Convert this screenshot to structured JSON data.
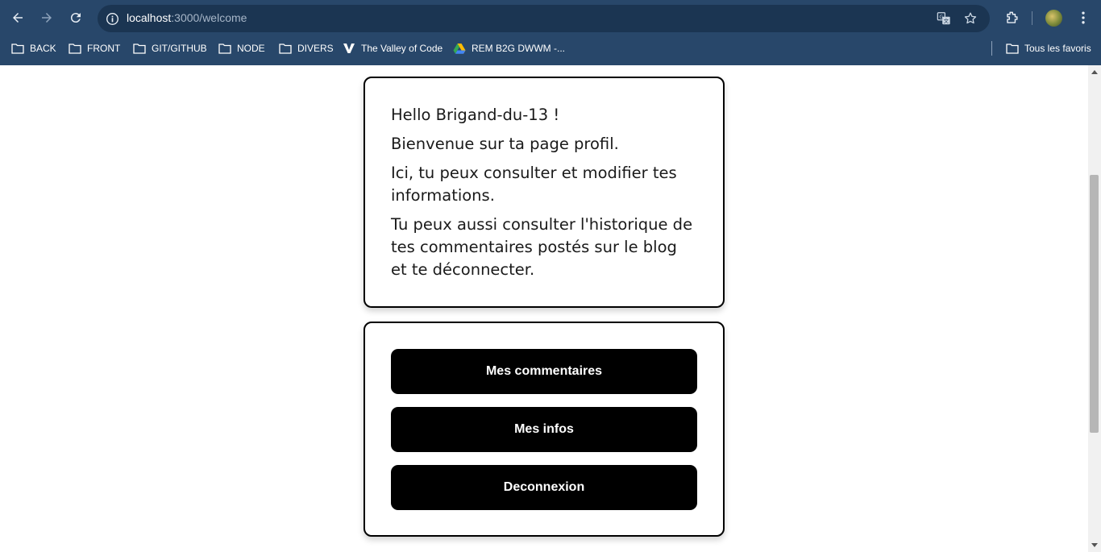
{
  "browser": {
    "url_host": "localhost",
    "url_path": ":3000/welcome",
    "bookmarks": [
      {
        "label": "BACK",
        "icon": "folder-icon"
      },
      {
        "label": "FRONT",
        "icon": "folder-icon"
      },
      {
        "label": "GIT/GITHUB",
        "icon": "folder-icon"
      },
      {
        "label": "NODE",
        "icon": "folder-icon"
      },
      {
        "label": "DIVERS",
        "icon": "folder-icon"
      },
      {
        "label": "The Valley of Code",
        "icon": "valley-logo-icon"
      },
      {
        "label": "REM B2G DWWM -...",
        "icon": "google-drive-icon"
      }
    ],
    "all_bookmarks_label": "Tous les favoris",
    "colors": {
      "chrome_bg": "#28476a",
      "omnibox_bg": "#1b3552"
    }
  },
  "profile": {
    "greeting": "Hello Brigand-du-13 !",
    "welcome": "Bienvenue sur ta page profil.",
    "info_text": "Ici, tu peux consulter et modifier tes informations.",
    "history_text": "Tu peux aussi consulter l'historique de tes commentaires postés sur le blog et te déconnecter."
  },
  "actions": {
    "comments_button": "Mes commentaires",
    "infos_button": "Mes infos",
    "logout_button": "Deconnexion"
  }
}
